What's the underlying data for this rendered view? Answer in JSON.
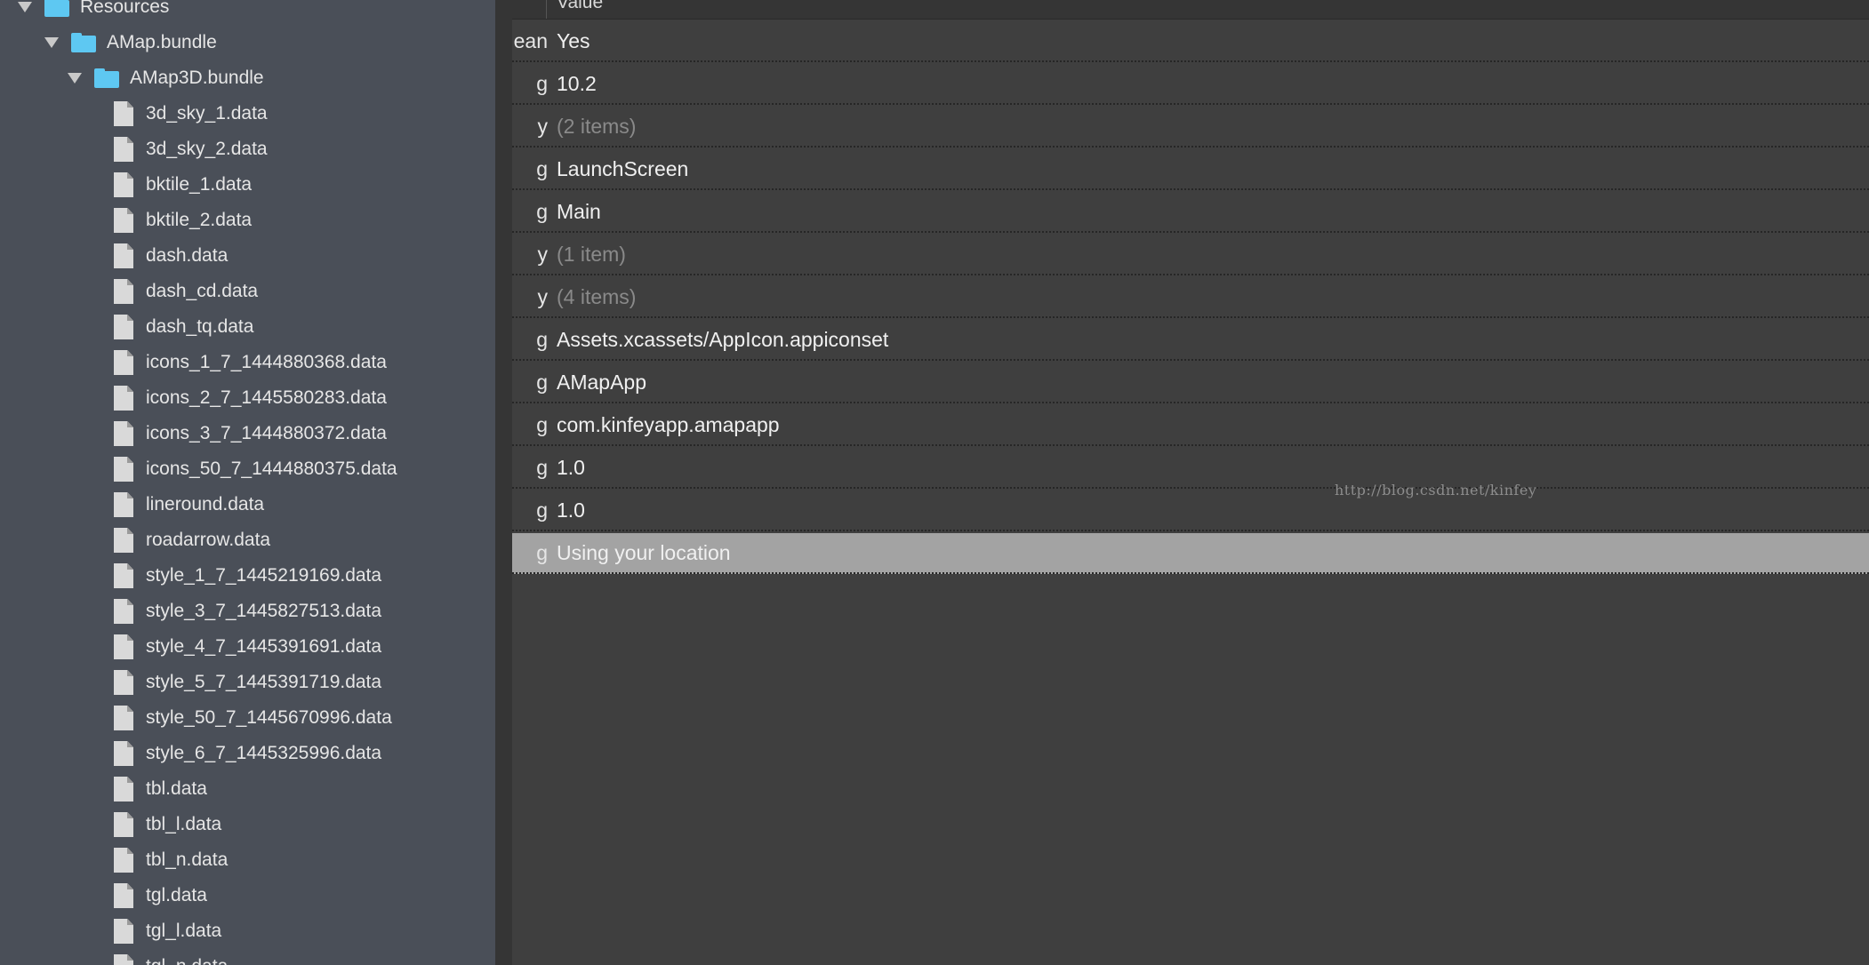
{
  "sidebar": {
    "tree": [
      {
        "label": "Resources",
        "kind": "folder",
        "expanded": true,
        "depth": 0
      },
      {
        "label": "AMap.bundle",
        "kind": "folder",
        "expanded": true,
        "depth": 1
      },
      {
        "label": "AMap3D.bundle",
        "kind": "folder",
        "expanded": true,
        "depth": 2
      },
      {
        "label": "3d_sky_1.data",
        "kind": "file",
        "depth": 3
      },
      {
        "label": "3d_sky_2.data",
        "kind": "file",
        "depth": 3
      },
      {
        "label": "bktile_1.data",
        "kind": "file",
        "depth": 3
      },
      {
        "label": "bktile_2.data",
        "kind": "file",
        "depth": 3
      },
      {
        "label": "dash.data",
        "kind": "file",
        "depth": 3
      },
      {
        "label": "dash_cd.data",
        "kind": "file",
        "depth": 3
      },
      {
        "label": "dash_tq.data",
        "kind": "file",
        "depth": 3
      },
      {
        "label": "icons_1_7_1444880368.data",
        "kind": "file",
        "depth": 3
      },
      {
        "label": "icons_2_7_1445580283.data",
        "kind": "file",
        "depth": 3
      },
      {
        "label": "icons_3_7_1444880372.data",
        "kind": "file",
        "depth": 3
      },
      {
        "label": "icons_50_7_1444880375.data",
        "kind": "file",
        "depth": 3
      },
      {
        "label": "lineround.data",
        "kind": "file",
        "depth": 3
      },
      {
        "label": "roadarrow.data",
        "kind": "file",
        "depth": 3
      },
      {
        "label": "style_1_7_1445219169.data",
        "kind": "file",
        "depth": 3
      },
      {
        "label": "style_3_7_1445827513.data",
        "kind": "file",
        "depth": 3
      },
      {
        "label": "style_4_7_1445391691.data",
        "kind": "file",
        "depth": 3
      },
      {
        "label": "style_5_7_1445391719.data",
        "kind": "file",
        "depth": 3
      },
      {
        "label": "style_50_7_1445670996.data",
        "kind": "file",
        "depth": 3
      },
      {
        "label": "style_6_7_1445325996.data",
        "kind": "file",
        "depth": 3
      },
      {
        "label": "tbl.data",
        "kind": "file",
        "depth": 3
      },
      {
        "label": "tbl_l.data",
        "kind": "file",
        "depth": 3
      },
      {
        "label": "tbl_n.data",
        "kind": "file",
        "depth": 3
      },
      {
        "label": "tgl.data",
        "kind": "file",
        "depth": 3
      },
      {
        "label": "tgl_l.data",
        "kind": "file",
        "depth": 3
      },
      {
        "label": "tgl_n.data",
        "kind": "file",
        "depth": 3
      }
    ]
  },
  "plist": {
    "header": {
      "value_label": "Value"
    },
    "rows": [
      {
        "type": "ean",
        "value": "Yes",
        "dim": false,
        "selected": false
      },
      {
        "type": "g",
        "value": "10.2",
        "dim": false,
        "selected": false
      },
      {
        "type": "y",
        "value": "(2 items)",
        "dim": true,
        "selected": false
      },
      {
        "type": "g",
        "value": "LaunchScreen",
        "dim": false,
        "selected": false
      },
      {
        "type": "g",
        "value": "Main",
        "dim": false,
        "selected": false
      },
      {
        "type": "y",
        "value": "(1 item)",
        "dim": true,
        "selected": false
      },
      {
        "type": "y",
        "value": "(4 items)",
        "dim": true,
        "selected": false
      },
      {
        "type": "g",
        "value": "Assets.xcassets/AppIcon.appiconset",
        "dim": false,
        "selected": false
      },
      {
        "type": "g",
        "value": "AMapApp",
        "dim": false,
        "selected": false
      },
      {
        "type": "g",
        "value": "com.kinfeyapp.amapapp",
        "dim": false,
        "selected": false
      },
      {
        "type": "g",
        "value": "1.0",
        "dim": false,
        "selected": false
      },
      {
        "type": "g",
        "value": "1.0",
        "dim": false,
        "selected": false
      },
      {
        "type": "g",
        "value": "Using your location",
        "dim": false,
        "selected": true
      }
    ]
  },
  "watermark": "http://blog.csdn.net/kinfey",
  "colors": {
    "sidebar_bg": "#4a4f58",
    "folder_accent": "#5ec8f2",
    "editor_bg": "#3f3f3f",
    "selected_row": "#a3a3a3"
  }
}
